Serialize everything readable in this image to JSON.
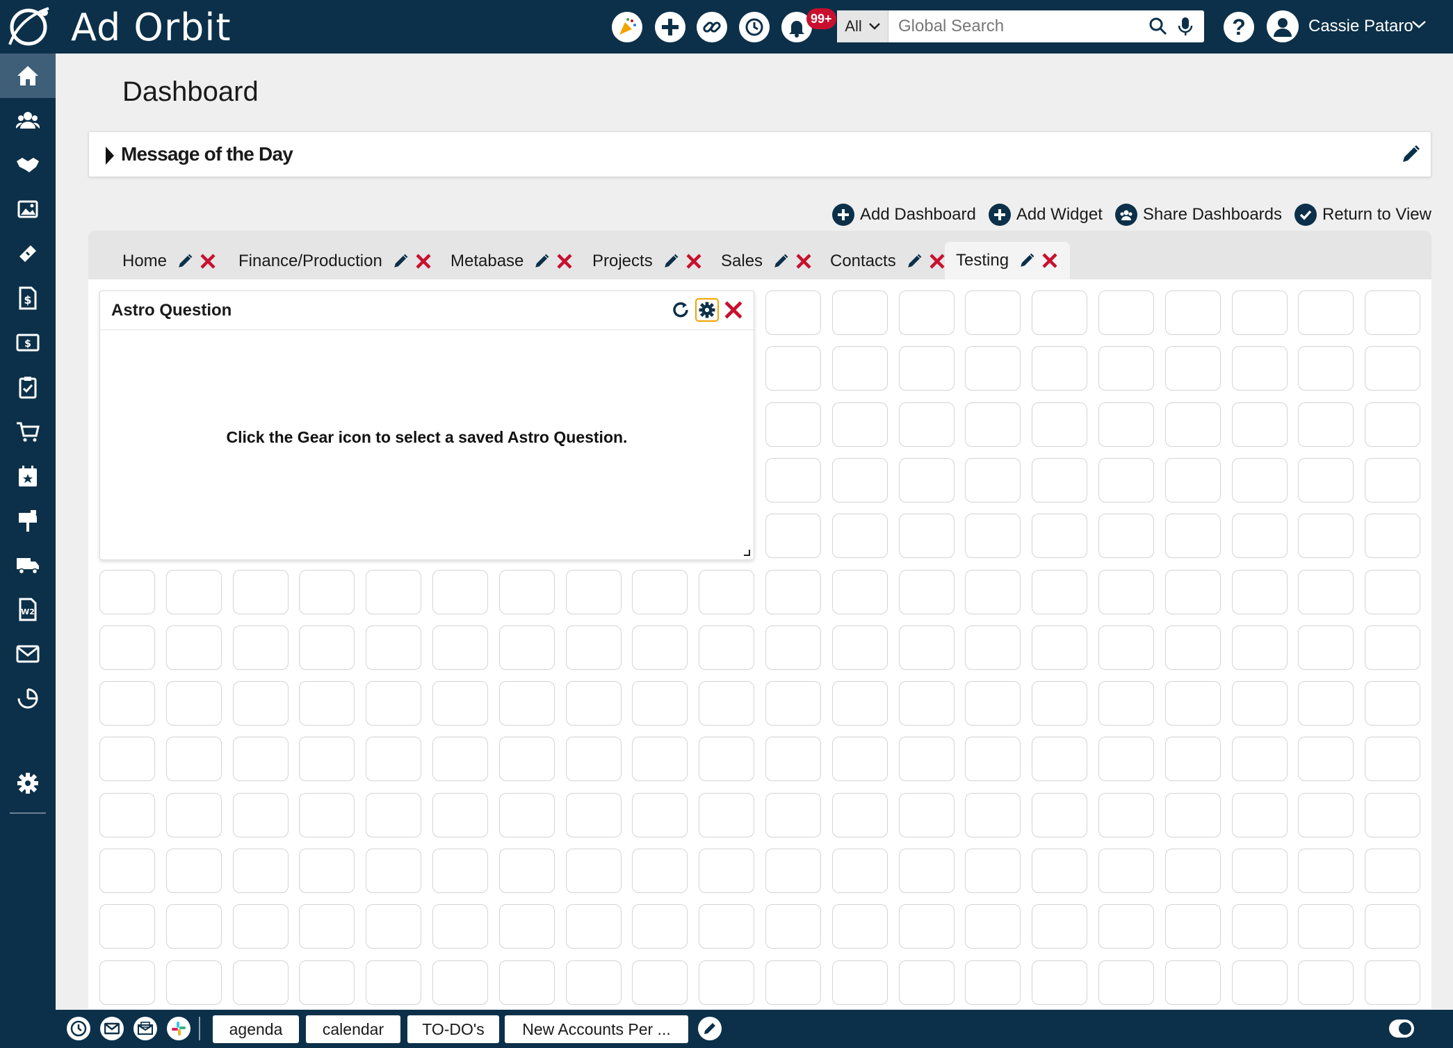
{
  "header": {
    "brand": "Ad Orbit",
    "notifications_badge": "99+",
    "search": {
      "scope": "All",
      "placeholder": "Global Search"
    },
    "user_name": "Cassie Pataro"
  },
  "page": {
    "title": "Dashboard"
  },
  "message_of_the_day": {
    "title": "Message of the Day"
  },
  "dashboard_actions": {
    "add_dashboard": "Add Dashboard",
    "add_widget": "Add Widget",
    "share_dashboards": "Share Dashboards",
    "return_to_view": "Return to View"
  },
  "tabs": [
    {
      "label": "Home"
    },
    {
      "label": "Finance/Production"
    },
    {
      "label": "Metabase"
    },
    {
      "label": "Projects"
    },
    {
      "label": "Sales"
    },
    {
      "label": "Contacts"
    },
    {
      "label": "Testing",
      "active": true
    }
  ],
  "widget": {
    "title": "Astro Question",
    "message": "Click the Gear icon to select a saved Astro Question."
  },
  "bottom_bar": {
    "tabs": [
      "agenda",
      "calendar",
      "TO-DO's",
      "New Accounts Per ..."
    ]
  },
  "colors": {
    "navy": "#0c3049",
    "delete_red": "#c8102e",
    "focus_orange": "#f0a400"
  }
}
